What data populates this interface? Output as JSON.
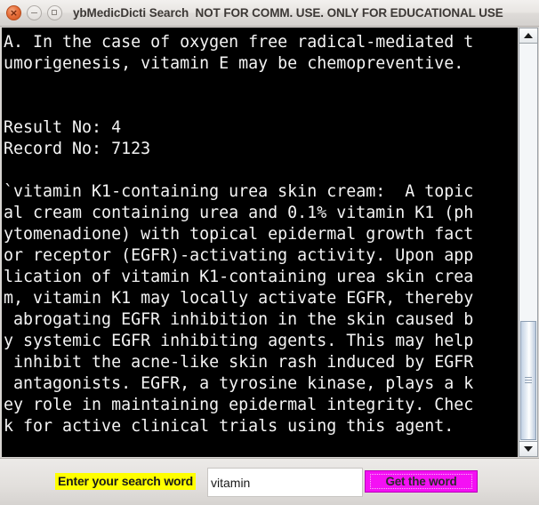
{
  "window": {
    "title_app": "ybMedicDicti Search",
    "title_notice": "NOT FOR COMM. USE.  ONLY FOR EDUCATIONAL USE",
    "controls": {
      "close_label": "×",
      "minimize_label": "–",
      "maximize_label": "□"
    }
  },
  "text_pane": {
    "content": "A. In the case of oxygen free radical-mediated t\numorigenesis, vitamin E may be chemopreventive.\n\n\nResult No: 4\nRecord No: 7123\n\n`vitamin K1-containing urea skin cream:  A topic\nal cream containing urea and 0.1% vitamin K1 (ph\nytomenadione) with topical epidermal growth fact\nor receptor (EGFR)-activating activity. Upon app\nlication of vitamin K1-containing urea skin crea\nm, vitamin K1 may locally activate EGFR, thereby\n abrogating EGFR inhibition in the skin caused b\ny systemic EGFR inhibiting agents. This may help\n inhibit the acne-like skin rash induced by EGFR\n antagonists. EGFR, a tyrosine kinase, plays a k\ney role in maintaining epidermal integrity. Chec\nk for active clinical trials using this agent.",
    "result_no": "4",
    "record_no": "7123",
    "background_color": "#000000",
    "text_color": "#f4f4f4"
  },
  "scrollbar": {
    "up_arrow": "scroll-up",
    "down_arrow": "scroll-down",
    "thumb_position_percent": 70
  },
  "footer": {
    "search_label": "Enter your search word",
    "search_value": "vitamin",
    "search_placeholder": "",
    "button_label": "Get the word",
    "label_highlight_color": "#ffff00",
    "button_color": "#f410f4"
  }
}
